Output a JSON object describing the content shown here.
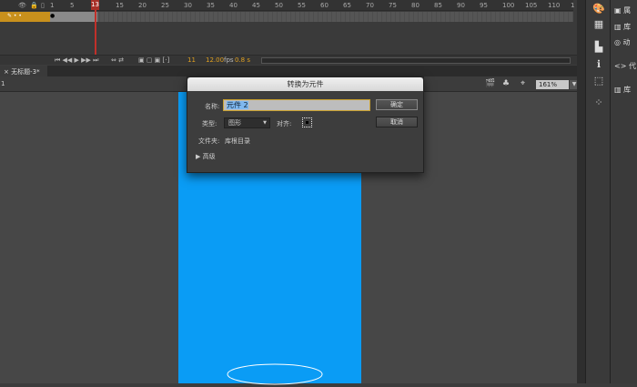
{
  "timeline": {
    "ruler_ticks": [
      "1",
      "5",
      "10",
      "15",
      "20",
      "25",
      "30",
      "35",
      "40",
      "45",
      "50",
      "55",
      "60",
      "65",
      "70",
      "75",
      "80",
      "85",
      "90",
      "95",
      "100",
      "105",
      "110",
      "1"
    ],
    "current_frame_marker": "13",
    "current_frame": "11",
    "fps": "12.00",
    "fps_unit": "fps",
    "time": "0.8 s"
  },
  "document_tab": {
    "label": "无标题-3*",
    "close": "×"
  },
  "stage": {
    "scene": "1",
    "zoom": "161%",
    "stage_color": "#0a9cf5"
  },
  "right_panel": {
    "items": [
      "属",
      "库",
      "动",
      "代",
      "库"
    ]
  },
  "dialog": {
    "title": "转换为元件",
    "name_label": "名称:",
    "name_value": "元件 2",
    "type_label": "类型:",
    "type_value": "图形",
    "align_label": "对齐:",
    "folder_label": "文件夹:",
    "folder_value": "库根目录",
    "advanced_label": "高级",
    "ok_label": "确定",
    "cancel_label": "取消"
  }
}
